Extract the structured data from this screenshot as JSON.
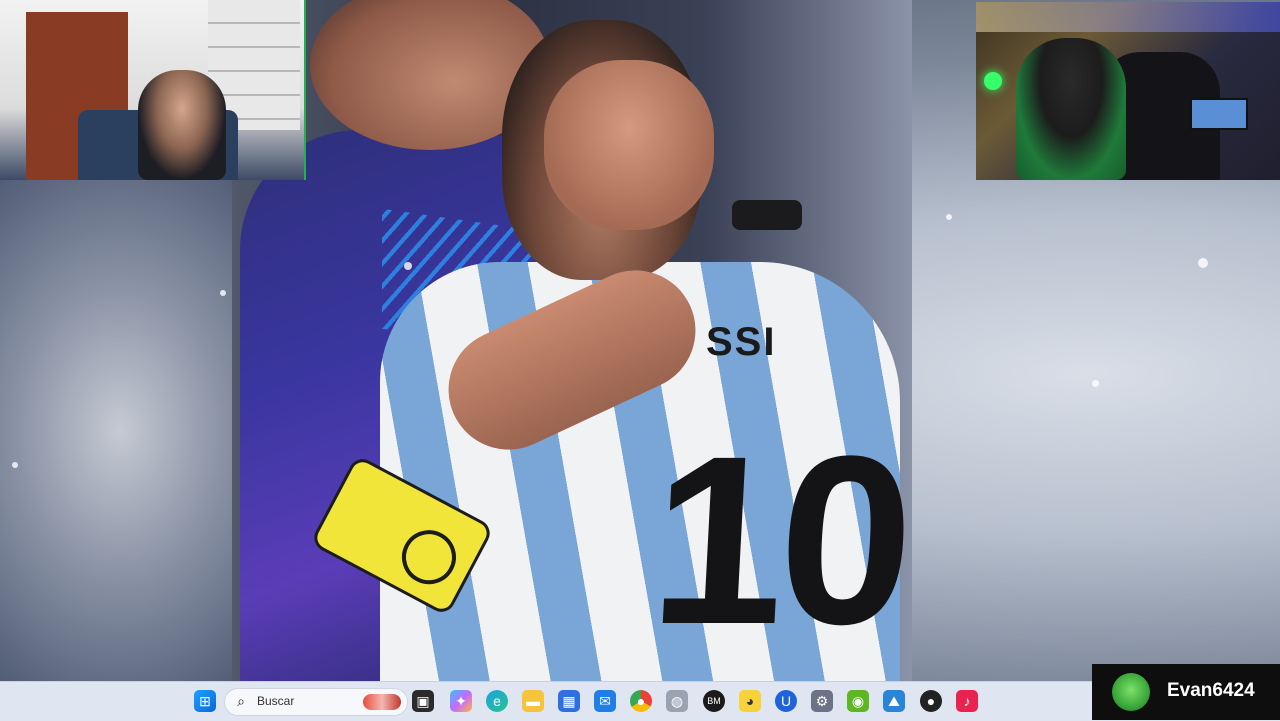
{
  "video": {
    "jersey_lettering": "SSI",
    "jersey_number": "10"
  },
  "taskbar": {
    "search_placeholder": "Buscar",
    "icons": [
      "windows-start-icon",
      "search-icon",
      "task-view-icon",
      "copilot-icon",
      "edge-icon",
      "file-explorer-icon",
      "microsoft-store-icon",
      "mail-icon",
      "chrome-icon",
      "mouse-icon",
      "bm-icon",
      "duck-app-icon",
      "u-app-icon",
      "settings-icon",
      "nvidia-icon",
      "photos-icon",
      "record-icon",
      "tiktok-icon"
    ]
  },
  "streamer_badge": {
    "username": "Evan6424"
  },
  "colors": {
    "taskbar_bg": "#dfe6f1",
    "badge_bg": "#0e0e0e",
    "webcam_border": "#22b14c"
  }
}
